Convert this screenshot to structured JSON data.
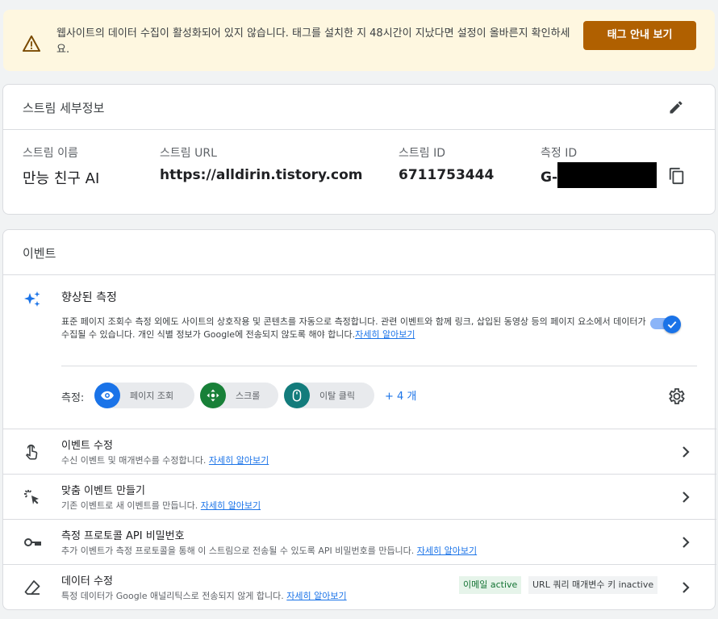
{
  "banner": {
    "message": "웹사이트의 데이터 수집이 활성화되어 있지 않습니다. 태그를 설치한 지 48시간이 지났다면 설정이 올바른지 확인하세요.",
    "button": "태그 안내 보기",
    "warning_color": "#b06000"
  },
  "stream": {
    "title": "스트림 세부정보",
    "name_label": "스트림 이름",
    "name_value": "만능 친구 AI",
    "url_label": "스트림 URL",
    "url_value": "https://alldirin.tistory.com",
    "id_label": "스트림 ID",
    "id_value": "6711753444",
    "measurement_label": "측정 ID",
    "measurement_value": "G-"
  },
  "events": {
    "title": "이벤트",
    "enhanced": {
      "title": "향상된 측정",
      "desc": "표준 페이지 조회수 측정 외에도 사이트의 상호작용 및 콘텐츠를 자동으로 측정합니다. 관련 이벤트와 함께 링크, 삽입된 동영상 등의 페이지 요소에서 데이터가 수집될 수 있습니다. 개인 식별 정보가 Google에 전송되지 않도록 해야 합니다.",
      "link": "자세히 알아보기",
      "toggle_on": true
    },
    "measure_label": "측정:",
    "chips": [
      {
        "label": "페이지 조회",
        "icon": "eye-icon",
        "color": "#1a73e8"
      },
      {
        "label": "스크롤",
        "icon": "scroll-icon",
        "color": "#188038"
      },
      {
        "label": "이탈 클릭",
        "icon": "mouse-icon",
        "color": "#137c7c"
      }
    ],
    "more": "+ 4 개",
    "rows": [
      {
        "title": "이벤트 수정",
        "desc": "수신 이벤트 및 매개변수를 수정합니다.",
        "link": "자세히 알아보기",
        "icon": "touch-icon"
      },
      {
        "title": "맞춤 이벤트 만들기",
        "desc": "기존 이벤트로 새 이벤트를 만듭니다.",
        "link": "자세히 알아보기",
        "icon": "sparkle-click-icon"
      },
      {
        "title": "측정 프로토콜 API 비밀번호",
        "desc": "추가 이벤트가 측정 프로토콜을 통해 이 스트림으로 전송될 수 있도록 API 비밀번호를 만듭니다.",
        "link": "자세히 알아보기",
        "icon": "key-icon"
      },
      {
        "title": "데이터 수정",
        "desc": "특정 데이터가 Google 애널리틱스로 전송되지 않게 합니다.",
        "link": "자세히 알아보기",
        "icon": "eraser-icon",
        "badge_email": "이메일 active",
        "badge_url": "URL 쿼리 매개변수 키 inactive"
      }
    ]
  }
}
